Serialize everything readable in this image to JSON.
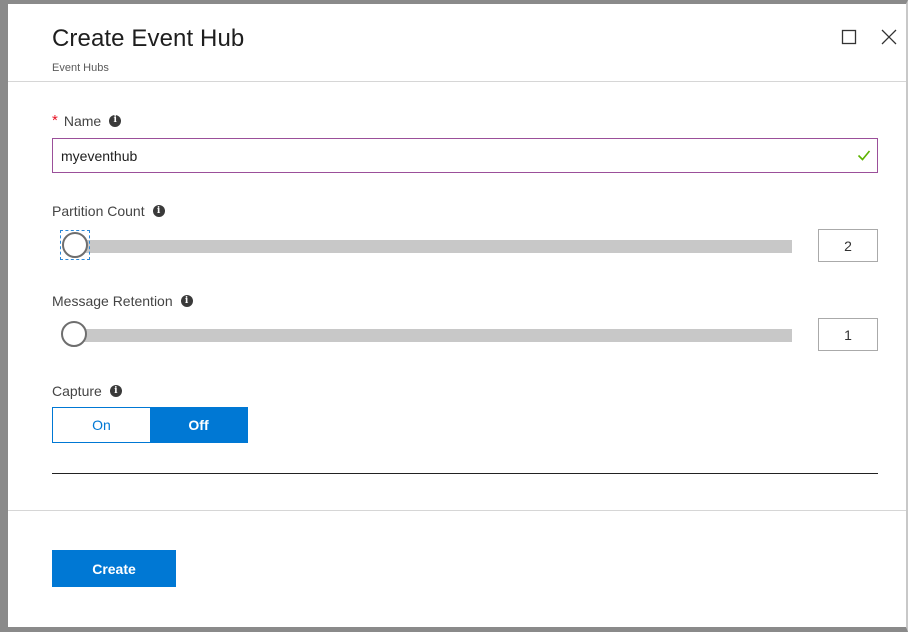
{
  "header": {
    "title": "Create Event Hub",
    "subtitle": "Event Hubs",
    "maximize_icon": "maximize-icon",
    "close_icon": "close-icon"
  },
  "form": {
    "name": {
      "required_marker": "*",
      "label": "Name",
      "value": "myeventhub",
      "valid": true
    },
    "partition_count": {
      "label": "Partition Count",
      "value": "2",
      "slider_fraction": 0.0
    },
    "message_retention": {
      "label": "Message Retention",
      "value": "1",
      "slider_fraction": 0.0
    },
    "capture": {
      "label": "Capture",
      "options": [
        "On",
        "Off"
      ],
      "selected": "Off"
    }
  },
  "footer": {
    "create_label": "Create"
  },
  "colors": {
    "accent": "#0078d4",
    "input_border": "#9b4f9a",
    "valid_check": "#5db300",
    "required": "#e81123"
  }
}
